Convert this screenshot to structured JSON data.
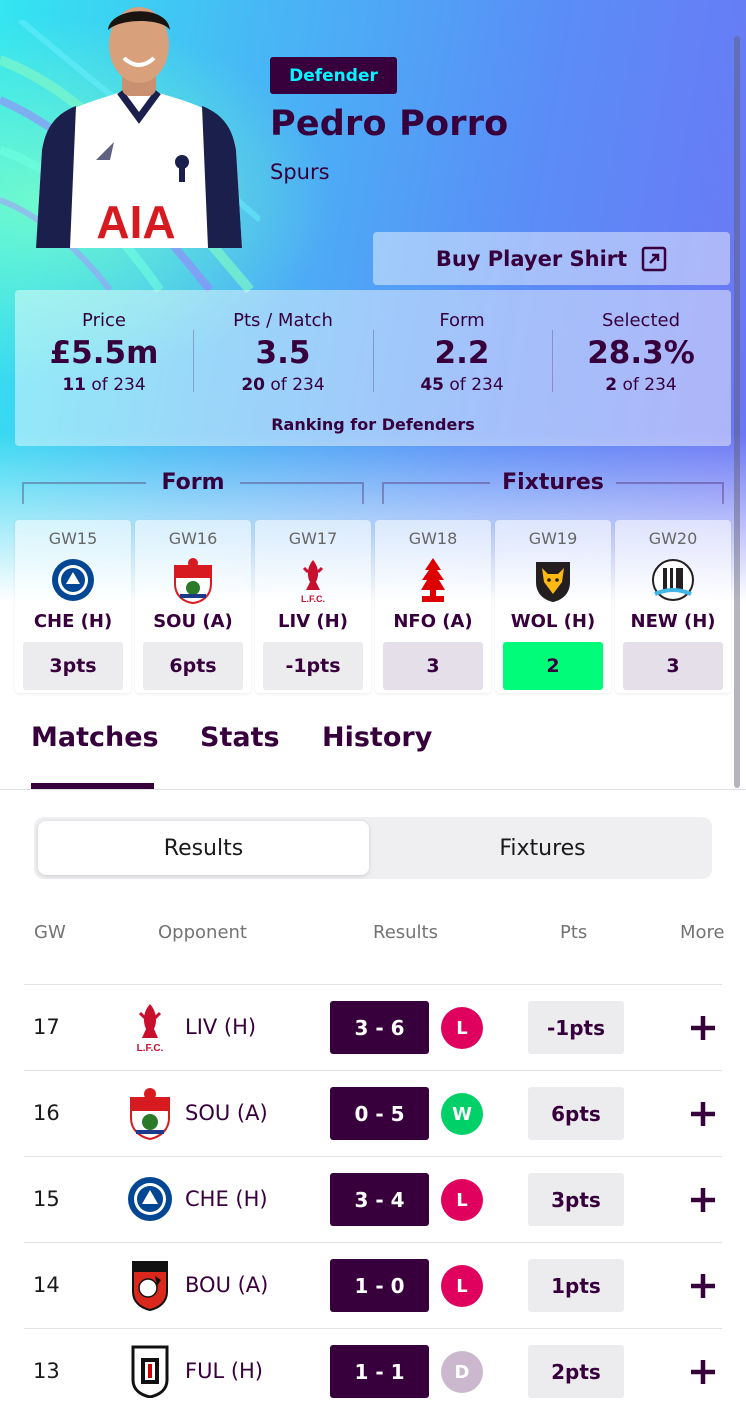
{
  "player": {
    "position": "Defender",
    "name": "Pedro Porro",
    "team": "Spurs",
    "shirt_sponsor": "AIA",
    "buy_shirt_label": "Buy Player Shirt"
  },
  "stats": [
    {
      "label": "Price",
      "value": "£5.5m",
      "rank": "11",
      "of": "of 234"
    },
    {
      "label": "Pts / Match",
      "value": "3.5",
      "rank": "20",
      "of": "of 234"
    },
    {
      "label": "Form",
      "value": "2.2",
      "rank": "45",
      "of": "of 234"
    },
    {
      "label": "Selected",
      "value": "28.3%",
      "rank": "2",
      "of": "of 234"
    }
  ],
  "ranking_caption": "Ranking for Defenders",
  "sections": {
    "form": "Form",
    "fixtures": "Fixtures"
  },
  "form_cards": [
    {
      "gw": "GW15",
      "opponent": "CHE (H)",
      "value": "3pts",
      "crest": "chelsea-crest"
    },
    {
      "gw": "GW16",
      "opponent": "SOU (A)",
      "value": "6pts",
      "crest": "southampton-crest"
    },
    {
      "gw": "GW17",
      "opponent": "LIV (H)",
      "value": "-1pts",
      "crest": "liverpool-crest"
    }
  ],
  "fixture_cards": [
    {
      "gw": "GW18",
      "opponent": "NFO (A)",
      "difficulty": "3",
      "crest": "nottingham-forest-crest"
    },
    {
      "gw": "GW19",
      "opponent": "WOL (H)",
      "difficulty": "2",
      "crest": "wolves-crest"
    },
    {
      "gw": "GW20",
      "opponent": "NEW (H)",
      "difficulty": "3",
      "crest": "newcastle-crest"
    }
  ],
  "tabs": [
    "Matches",
    "Stats",
    "History"
  ],
  "active_tab": "Matches",
  "segment": {
    "results": "Results",
    "fixtures": "Fixtures",
    "active": "Results"
  },
  "table_headers": {
    "gw": "GW",
    "opponent": "Opponent",
    "results": "Results",
    "pts": "Pts",
    "more": "More"
  },
  "matches": [
    {
      "gw": "17",
      "opponent": "LIV (H)",
      "score": "3 - 6",
      "result": "L",
      "pts": "-1pts",
      "crest": "liverpool-crest"
    },
    {
      "gw": "16",
      "opponent": "SOU (A)",
      "score": "0 - 5",
      "result": "W",
      "pts": "6pts",
      "crest": "southampton-crest"
    },
    {
      "gw": "15",
      "opponent": "CHE (H)",
      "score": "3 - 4",
      "result": "L",
      "pts": "3pts",
      "crest": "chelsea-crest"
    },
    {
      "gw": "14",
      "opponent": "BOU (A)",
      "score": "1 - 0",
      "result": "L",
      "pts": "1pts",
      "crest": "bournemouth-crest"
    },
    {
      "gw": "13",
      "opponent": "FUL (H)",
      "score": "1 - 1",
      "result": "D",
      "pts": "2pts",
      "crest": "fulham-crest"
    }
  ],
  "colors": {
    "primary": "#37003c",
    "accent_cyan": "#04f5ff",
    "win": "#00d068",
    "loss": "#e0005e",
    "draw": "#cbb8cf",
    "fdr_easy": "#01fc7a"
  }
}
